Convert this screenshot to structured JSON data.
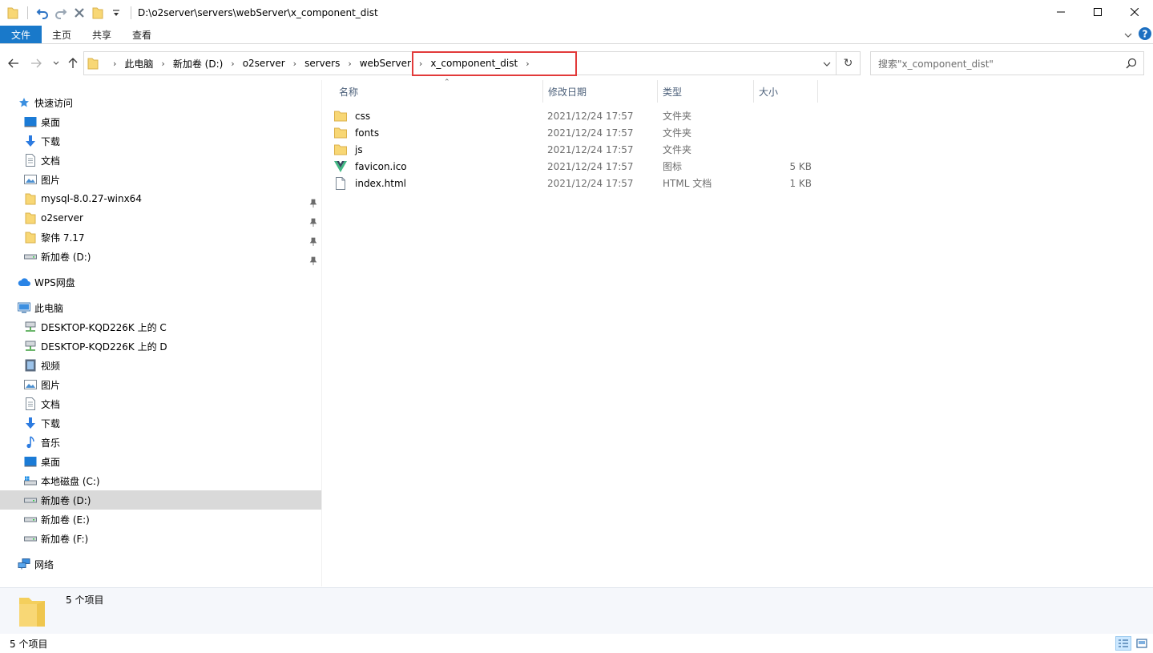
{
  "window": {
    "title": "D:\\o2server\\servers\\webServer\\x_component_dist",
    "controls": [
      "minimize",
      "maximize",
      "close"
    ]
  },
  "ribbon": {
    "tabs": [
      "文件",
      "主页",
      "共享",
      "查看"
    ]
  },
  "address": {
    "crumbs": [
      "此电脑",
      "新加卷 (D:)",
      "o2server",
      "servers",
      "webServer",
      "x_component_dist"
    ],
    "highlight_color": "#e23a3a"
  },
  "search": {
    "placeholder": "搜索\"x_component_dist\""
  },
  "nav": {
    "quick_access": "快速访问",
    "quick_items": [
      {
        "label": "桌面",
        "icon": "desktop-icon",
        "pinned": true
      },
      {
        "label": "下载",
        "icon": "download-icon",
        "pinned": true
      },
      {
        "label": "文档",
        "icon": "document-icon",
        "pinned": true
      },
      {
        "label": "图片",
        "icon": "picture-icon",
        "pinned": true
      },
      {
        "label": "mysql-8.0.27-winx64",
        "icon": "folder-icon",
        "pinned": false
      },
      {
        "label": "o2server",
        "icon": "folder-icon",
        "pinned": false
      },
      {
        "label": "黎伟 7.17",
        "icon": "folder-icon",
        "pinned": false
      },
      {
        "label": "新加卷 (D:)",
        "icon": "drive-icon",
        "pinned": false
      }
    ],
    "wps": "WPS网盘",
    "this_pc": "此电脑",
    "pc_items": [
      {
        "label": "DESKTOP-KQD226K 上的 C",
        "icon": "network-drive-icon"
      },
      {
        "label": "DESKTOP-KQD226K 上的 D",
        "icon": "network-drive-icon"
      },
      {
        "label": "视频",
        "icon": "video-icon"
      },
      {
        "label": "图片",
        "icon": "picture-icon"
      },
      {
        "label": "文档",
        "icon": "document-icon"
      },
      {
        "label": "下载",
        "icon": "download-icon"
      },
      {
        "label": "音乐",
        "icon": "music-icon"
      },
      {
        "label": "桌面",
        "icon": "desktop-icon"
      },
      {
        "label": "本地磁盘 (C:)",
        "icon": "system-drive-icon"
      },
      {
        "label": "新加卷 (D:)",
        "icon": "drive-icon",
        "selected": true
      },
      {
        "label": "新加卷 (E:)",
        "icon": "drive-icon"
      },
      {
        "label": "新加卷 (F:)",
        "icon": "drive-icon"
      }
    ],
    "network": "网络"
  },
  "columns": {
    "name": "名称",
    "date": "修改日期",
    "type": "类型",
    "size": "大小"
  },
  "files": [
    {
      "name": "css",
      "date": "2021/12/24 17:57",
      "type": "文件夹",
      "size": "",
      "icon": "folder-icon"
    },
    {
      "name": "fonts",
      "date": "2021/12/24 17:57",
      "type": "文件夹",
      "size": "",
      "icon": "folder-icon"
    },
    {
      "name": "js",
      "date": "2021/12/24 17:57",
      "type": "文件夹",
      "size": "",
      "icon": "folder-icon"
    },
    {
      "name": "favicon.ico",
      "date": "2021/12/24 17:57",
      "type": "图标",
      "size": "5 KB",
      "icon": "vue-logo-icon"
    },
    {
      "name": "index.html",
      "date": "2021/12/24 17:57",
      "type": "HTML 文档",
      "size": "1 KB",
      "icon": "html-file-icon"
    }
  ],
  "details": {
    "count": "5 个项目"
  },
  "status": {
    "count": "5 个项目"
  },
  "colors": {
    "accent": "#1979ca",
    "folder": "#f8d775",
    "selection": "#d9d9d9"
  }
}
